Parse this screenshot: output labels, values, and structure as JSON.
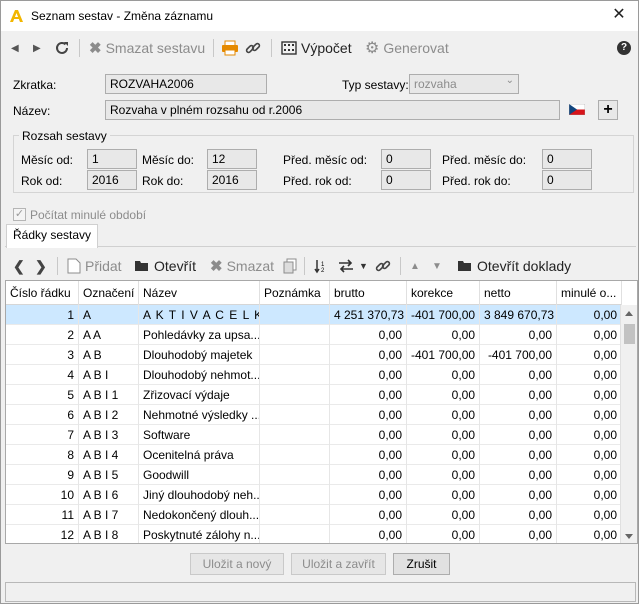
{
  "window": {
    "title": "Seznam sestav - Změna záznamu",
    "close_glyph": "✕"
  },
  "toolbar": {
    "prev_glyph": "◀",
    "next_glyph": "▶",
    "delete_label": "Smazat sestavu",
    "compute_label": "Výpočet",
    "generate_label": "Generovat",
    "help_glyph": "?"
  },
  "form": {
    "shortcut_label": "Zkratka:",
    "shortcut_value": "ROZVAHA2006",
    "type_label": "Typ sestavy:",
    "type_value": "rozvaha",
    "name_label": "Název:",
    "name_value": "Rozvaha v plném rozsahu od r.2006",
    "add_glyph": "+"
  },
  "range": {
    "title": "Rozsah sestavy",
    "month_from_label": "Měsíc od:",
    "month_from": "1",
    "month_to_label": "Měsíc do:",
    "month_to": "12",
    "prev_month_from_label": "Před. měsíc od:",
    "prev_month_from": "0",
    "prev_month_to_label": "Před. měsíc do:",
    "prev_month_to": "0",
    "year_from_label": "Rok od:",
    "year_from": "2016",
    "year_to_label": "Rok do:",
    "year_to": "2016",
    "prev_year_from_label": "Před. rok od:",
    "prev_year_from": "0",
    "prev_year_to_label": "Před. rok do:",
    "prev_year_to": "0"
  },
  "compute_prev": {
    "label": "Počítat minulé období",
    "check_glyph": "✓"
  },
  "tabs": [
    {
      "label": "Řádky sestavy"
    }
  ],
  "rows_toolbar": {
    "prev_glyph": "❮",
    "next_glyph": "❯",
    "add_label": "Přidat",
    "open_label": "Otevřít",
    "delete_label": "Smazat",
    "open_docs_label": "Otevřít doklady"
  },
  "table": {
    "columns": [
      "Číslo řádku",
      "Označení",
      "Název",
      "Poznámka",
      "brutto",
      "korekce",
      "netto",
      "minulé o..."
    ],
    "rows": [
      {
        "no": "1",
        "code": "A",
        "name": "A K T I V A   C E L K...",
        "note": "",
        "brutto": "4 251 370,73",
        "korekce": "-401 700,00",
        "netto": "3 849 670,73",
        "prev": "0,00"
      },
      {
        "no": "2",
        "code": "A  A",
        "name": "Pohledávky za upsa...",
        "note": "",
        "brutto": "0,00",
        "korekce": "0,00",
        "netto": "0,00",
        "prev": "0,00"
      },
      {
        "no": "3",
        "code": "A  B",
        "name": "Dlouhodobý majetek",
        "note": "",
        "brutto": "0,00",
        "korekce": "-401 700,00",
        "netto": "-401 700,00",
        "prev": "0,00"
      },
      {
        "no": "4",
        "code": "A  B  I",
        "name": "Dlouhodobý nehmot...",
        "note": "",
        "brutto": "0,00",
        "korekce": "0,00",
        "netto": "0,00",
        "prev": "0,00"
      },
      {
        "no": "5",
        "code": "A  B  I  1",
        "name": "Zřizovací výdaje",
        "note": "",
        "brutto": "0,00",
        "korekce": "0,00",
        "netto": "0,00",
        "prev": "0,00"
      },
      {
        "no": "6",
        "code": "A  B  I  2",
        "name": "Nehmotné výsledky ...",
        "note": "",
        "brutto": "0,00",
        "korekce": "0,00",
        "netto": "0,00",
        "prev": "0,00"
      },
      {
        "no": "7",
        "code": "A  B  I  3",
        "name": "Software",
        "note": "",
        "brutto": "0,00",
        "korekce": "0,00",
        "netto": "0,00",
        "prev": "0,00"
      },
      {
        "no": "8",
        "code": "A  B  I  4",
        "name": "Ocenitelná práva",
        "note": "",
        "brutto": "0,00",
        "korekce": "0,00",
        "netto": "0,00",
        "prev": "0,00"
      },
      {
        "no": "9",
        "code": "A  B  I  5",
        "name": "Goodwill",
        "note": "",
        "brutto": "0,00",
        "korekce": "0,00",
        "netto": "0,00",
        "prev": "0,00"
      },
      {
        "no": "10",
        "code": "A  B  I  6",
        "name": "Jiný dlouhodobý neh...",
        "note": "",
        "brutto": "0,00",
        "korekce": "0,00",
        "netto": "0,00",
        "prev": "0,00"
      },
      {
        "no": "11",
        "code": "A  B  I  7",
        "name": "Nedokončený dlouh...",
        "note": "",
        "brutto": "0,00",
        "korekce": "0,00",
        "netto": "0,00",
        "prev": "0,00"
      },
      {
        "no": "12",
        "code": "A  B  I  8",
        "name": "Poskytnuté zálohy n...",
        "note": "",
        "brutto": "0,00",
        "korekce": "0,00",
        "netto": "0,00",
        "prev": "0,00"
      }
    ]
  },
  "footer": {
    "save_new_label": "Uložit a nový",
    "save_close_label": "Uložit a zavřít",
    "cancel_label": "Zrušit"
  },
  "colors": {
    "selected_row": "#cde8ff",
    "accent_orange": "#e58a00",
    "link_blue": "#1f5fa8"
  }
}
